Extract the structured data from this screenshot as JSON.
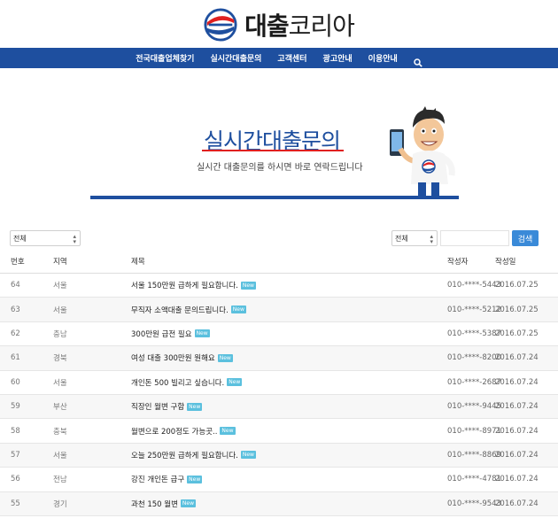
{
  "header": {
    "logo_bold": "대출",
    "logo_rest": "코리아"
  },
  "nav": {
    "items": [
      "전국대출업체찾기",
      "실시간대출문의",
      "고객센터",
      "광고안내",
      "이용안내"
    ],
    "search_icon": "search-icon"
  },
  "hero": {
    "title": "실시간대출문의",
    "subtitle": "실시간 대출문의를 하시면 바로 연락드립니다"
  },
  "filters": {
    "region_select": "전체",
    "field_select": "전체",
    "search_value": "",
    "search_button": "검색"
  },
  "table": {
    "headers": {
      "num": "번호",
      "region": "지역",
      "title": "제목",
      "author": "작성자",
      "date": "작성일"
    },
    "new_badge": "New",
    "rows": [
      {
        "num": "64",
        "region": "서울",
        "title": "서울 150만원 급하게 필요합니다.",
        "author": "010-****-5443",
        "date": "2016.07.25"
      },
      {
        "num": "63",
        "region": "서울",
        "title": "무직자 소액대출 문의드립니다.",
        "author": "010-****-5212",
        "date": "2016.07.25"
      },
      {
        "num": "62",
        "region": "충남",
        "title": "300만원 급전 필요",
        "author": "010-****-5387",
        "date": "2016.07.25"
      },
      {
        "num": "61",
        "region": "경북",
        "title": "여성 대출 300만원 원해요",
        "author": "010-****-8200",
        "date": "2016.07.24"
      },
      {
        "num": "60",
        "region": "서울",
        "title": "개인돈 500 빌리고 싶습니다.",
        "author": "010-****-2687",
        "date": "2016.07.24"
      },
      {
        "num": "59",
        "region": "부산",
        "title": "직장인 월변 구함",
        "author": "010-****-9445",
        "date": "2016.07.24"
      },
      {
        "num": "58",
        "region": "충북",
        "title": "월변으로 200정도 가능곳..",
        "author": "010-****-8971",
        "date": "2016.07.24"
      },
      {
        "num": "57",
        "region": "서울",
        "title": "오늘 250만원 급하게 필요합니다.",
        "author": "010-****-8869",
        "date": "2016.07.24"
      },
      {
        "num": "56",
        "region": "전남",
        "title": "강진 개인돈 급구",
        "author": "010-****-4781",
        "date": "2016.07.24"
      },
      {
        "num": "55",
        "region": "경기",
        "title": "과천 150 월변",
        "author": "010-****-9543",
        "date": "2016.07.24"
      }
    ]
  }
}
